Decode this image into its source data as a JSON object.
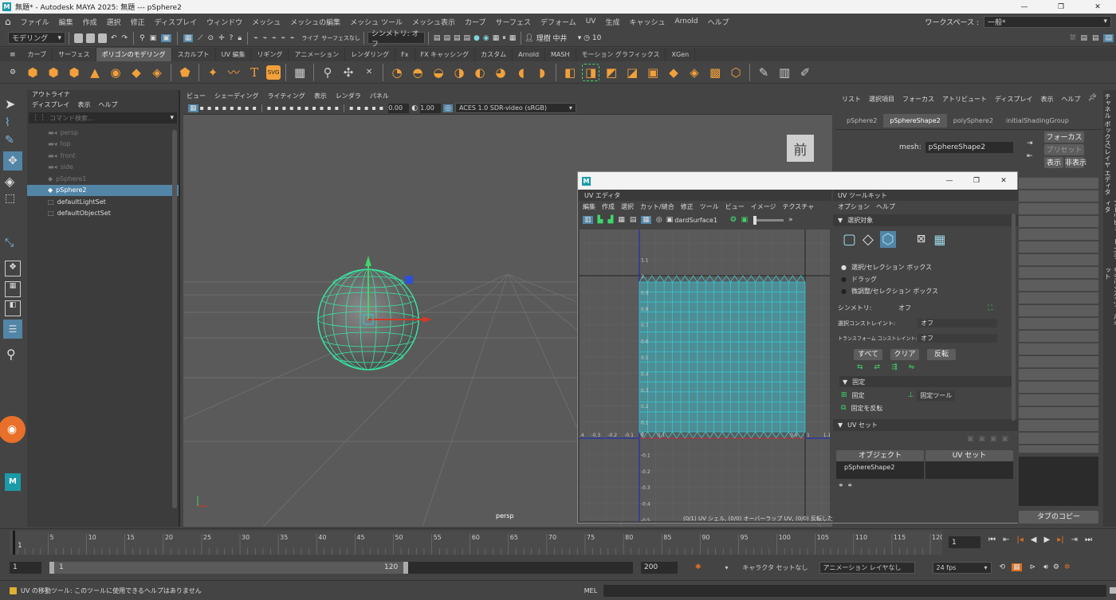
{
  "titlebar": {
    "title": "無題* - Autodesk MAYA 2025: 無題  ---  pSphere2",
    "controls": [
      "—",
      "❐",
      "✕"
    ]
  },
  "menubar": {
    "items": [
      "ファイル",
      "編集",
      "作成",
      "選択",
      "修正",
      "ディスプレイ",
      "ウィンドウ",
      "メッシュ",
      "メッシュの編集",
      "メッシュ ツール",
      "メッシュ表示",
      "カーブ",
      "サーフェス",
      "デフォーム",
      "UV",
      "生成",
      "キャッシュ",
      "Arnold",
      "ヘルプ"
    ],
    "workspace_label": "ワークスペース :",
    "workspace_value": "一般*"
  },
  "statusline": {
    "mode": "モデリング",
    "live": "ライブ",
    "live_surface": "サーフェスなし",
    "symmetry": "シンメトリ: オフ",
    "user": "理樹 中井",
    "count": "10"
  },
  "shelf": {
    "tabs": [
      "カーブ",
      "サーフェス",
      "ポリゴンのモデリング",
      "スカルプト",
      "UV 編集",
      "リギング",
      "アニメーション",
      "レンダリング",
      "Fx",
      "FX キャッシング",
      "カスタム",
      "Arnold",
      "MASH",
      "モーション グラフィックス",
      "XGen"
    ],
    "active_tab": "ポリゴンのモデリング",
    "text_tool": "T",
    "svg_tool": "SVG"
  },
  "outliner": {
    "title": "アウトライナ",
    "menus": [
      "ディスプレイ",
      "表示",
      "ヘルプ"
    ],
    "search_placeholder": "コマンド検索...",
    "items": [
      {
        "label": "persp",
        "dim": true
      },
      {
        "label": "top",
        "dim": true
      },
      {
        "label": "front",
        "dim": true
      },
      {
        "label": "side",
        "dim": true
      },
      {
        "label": "pSphere1",
        "dim": true
      },
      {
        "label": "pSphere2",
        "dim": false,
        "selected": true
      },
      {
        "label": "defaultLightSet",
        "dim": false
      },
      {
        "label": "defaultObjectSet",
        "dim": false
      }
    ]
  },
  "viewport": {
    "menus": [
      "ビュー",
      "シェーディング",
      "ライティング",
      "表示",
      "レンダラ",
      "パネル"
    ],
    "field1": "0.00",
    "field2": "1.00",
    "colorspace": "ACES 1.0 SDR-video (sRGB)",
    "camera_label": "persp",
    "view_cube": "前"
  },
  "attr_editor": {
    "menus": [
      "リスト",
      "選択項目",
      "フォーカス",
      "アトリビュート",
      "ディスプレイ",
      "表示",
      "ヘルプ"
    ],
    "tabs": [
      "pSphere2",
      "pSphereShape2",
      "polySphere2",
      "initialShadingGroup"
    ],
    "active_tab": "pSphereShape2",
    "mesh_label": "mesh:",
    "mesh_value": "pSphereShape2",
    "focus_btn": "フォーカス",
    "preset_btn": "プリセット",
    "show_btn": "表示",
    "hide_btn": "非表示",
    "copy_tab_btn": "タブのコピー"
  },
  "right_strip": {
    "tabs": [
      "チャネル ボックス/レイヤ エディタ",
      "アトリビュート エディタ",
      "モデリング ツールキット"
    ]
  },
  "uv_window": {
    "title": "",
    "editor_tab": "UV エディタ",
    "menus": [
      "編集",
      "作成",
      "選択",
      "カット/縫合",
      "修正",
      "ツール",
      "ビュー",
      "イメージ",
      "テクスチャ"
    ],
    "surface_label": "dardSurface1",
    "status": "(0/1) UV シェル, (0/0) オーバーラップ UV, (0/0) 反転した UV",
    "v_ticks": [
      "1.1",
      "1",
      "0.9",
      "0.8",
      "0.7",
      "0.6",
      "0.5",
      "0.4",
      "0.3",
      "0.2",
      "0.1",
      "0",
      "-0.1",
      "-0.2",
      "-0.3",
      "-0.4",
      "-0.5"
    ],
    "u_ticks": [
      "-0.4",
      "-0.3",
      "-0.2",
      "-0.1",
      "0",
      "0.1",
      "0.9",
      "1",
      "1.1"
    ],
    "toolkit": {
      "tab": "UV ツールキット",
      "menus": [
        "オプション",
        "ヘルプ"
      ],
      "section_select": "選択対象",
      "radios": [
        "選択/セレクション ボックス",
        "ドラッグ",
        "微調整/セレクション ボックス"
      ],
      "symmetry_label": "シンメトリ:",
      "symmetry_value": "オフ",
      "select_constraint_label": "選択コンストレイント:",
      "select_constraint_value": "オフ",
      "transform_constraint_label": "トランスフォーム コンストレイント:",
      "transform_constraint_value": "オフ",
      "btn_all": "すべて",
      "btn_clear": "クリア",
      "btn_invert": "反転",
      "section_pin": "固定",
      "pin_btn": "固定",
      "pin_tool_btn": "固定ツール",
      "pin_invert_btn": "固定を反転",
      "section_uvset": "UV セット",
      "col_object": "オブジェクト",
      "col_uvset": "UV セット",
      "row_object": "pSphereShape2"
    }
  },
  "timeline": {
    "ticks": [
      "5",
      "10",
      "15",
      "20",
      "25",
      "30",
      "35",
      "40",
      "45",
      "50",
      "55",
      "60",
      "65",
      "70",
      "75",
      "80",
      "85",
      "90",
      "95",
      "100",
      "105",
      "110",
      "115",
      "120"
    ],
    "current": "1",
    "current_frame_field": "1"
  },
  "range": {
    "start": "1",
    "inner_start": "1",
    "inner_end": "120",
    "end": "200",
    "character_set": "キャラクタ セットなし",
    "anim_layer": "アニメーション レイヤなし",
    "fps": "24 fps"
  },
  "helpline": {
    "text": "UV の移動ツール: このツールに使用できるヘルプはありません",
    "mel_label": "MEL"
  },
  "colors": {
    "accent_blue": "#5285a6",
    "uv_cyan": "#36c6d6",
    "wire_green": "#39e3a2",
    "maya_teal": "#1b9aa8"
  }
}
